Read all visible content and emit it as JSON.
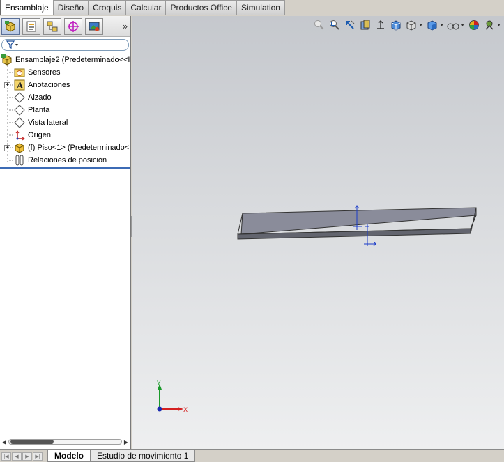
{
  "command_tabs": [
    "Ensamblaje",
    "Diseño",
    "Croquis",
    "Calcular",
    "Productos Office",
    "Simulation"
  ],
  "active_command_tab": "Ensamblaje",
  "feature_manager": {
    "more_glyph": "»",
    "filter_icon": "filter-icon",
    "tree": [
      {
        "label": "Ensamblaje2  (Predeterminado<<I",
        "icon": "assembly-icon",
        "level": 0,
        "expandable": false
      },
      {
        "label": "Sensores",
        "icon": "sensor-folder-icon",
        "level": 1,
        "expandable": false
      },
      {
        "label": "Anotaciones",
        "icon": "annotations-icon",
        "level": 1,
        "expandable": true
      },
      {
        "label": "Alzado",
        "icon": "plane-icon",
        "level": 1,
        "expandable": false
      },
      {
        "label": "Planta",
        "icon": "plane-icon",
        "level": 1,
        "expandable": false
      },
      {
        "label": "Vista lateral",
        "icon": "plane-icon",
        "level": 1,
        "expandable": false
      },
      {
        "label": "Origen",
        "icon": "origin-icon",
        "level": 1,
        "expandable": false
      },
      {
        "label": "(f) Piso<1> (Predeterminado<",
        "icon": "part-icon",
        "level": 1,
        "expandable": true
      },
      {
        "label": "Relaciones de posición",
        "icon": "mates-icon",
        "level": 1,
        "expandable": false
      }
    ]
  },
  "triad": {
    "x_label": "X",
    "y_label": "Y"
  },
  "bottom_tabs": [
    "Modelo",
    "Estudio de movimiento 1"
  ],
  "active_bottom_tab": "Modelo",
  "colors": {
    "accent_blue": "#3c6bb5",
    "part_gray": "#8a8c9a",
    "triad_x": "#d42020",
    "triad_y": "#1a9a2a"
  }
}
